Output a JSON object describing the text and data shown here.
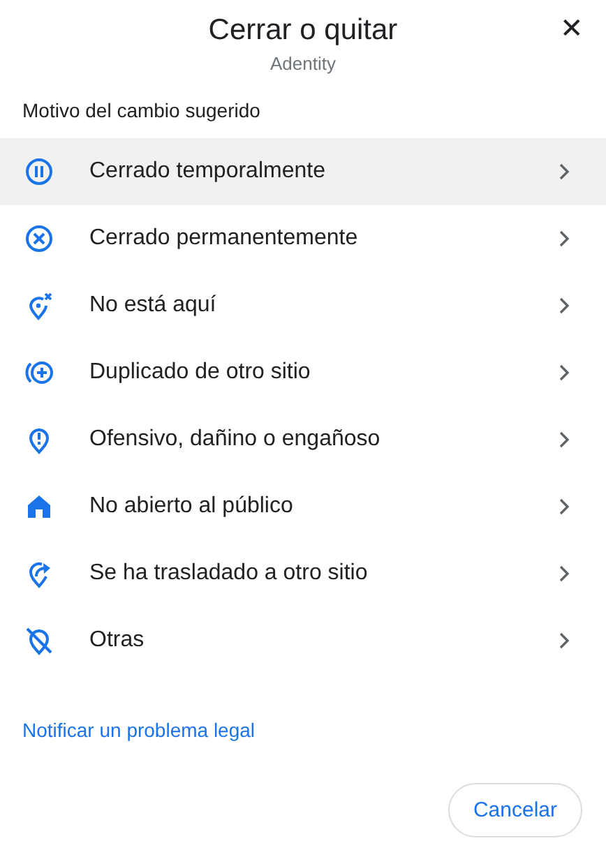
{
  "header": {
    "title": "Cerrar o quitar",
    "subtitle": "Adentity",
    "close": "✕"
  },
  "section_label": "Motivo del cambio sugerido",
  "reasons": [
    {
      "label": "Cerrado temporalmente",
      "selected": true
    },
    {
      "label": "Cerrado permanentemente",
      "selected": false
    },
    {
      "label": "No está aquí",
      "selected": false
    },
    {
      "label": "Duplicado de otro sitio",
      "selected": false
    },
    {
      "label": "Ofensivo, dañino o engañoso",
      "selected": false
    },
    {
      "label": "No abierto al público",
      "selected": false
    },
    {
      "label": "Se ha trasladado a otro sitio",
      "selected": false
    },
    {
      "label": "Otras",
      "selected": false
    }
  ],
  "legal_link": "Notificar un problema legal",
  "buttons": [
    "Cancelar"
  ]
}
